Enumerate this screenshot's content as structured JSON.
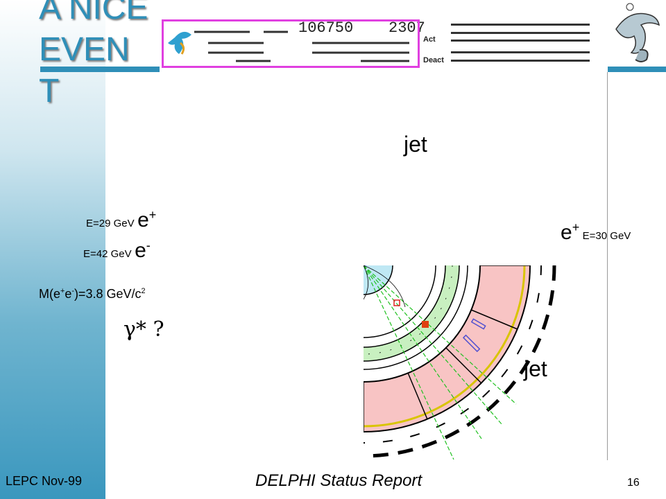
{
  "slide": {
    "title": "A NICE EVEN T",
    "footer_left": "LEPC Nov-99",
    "footer_center": "DELPHI Status Report",
    "page_number": "16"
  },
  "header": {
    "run_number": "106750",
    "event_number": "2307",
    "act_label": "Act",
    "deact_label": "Deact"
  },
  "labels": {
    "jet_top": "jet",
    "jet_bottom": "jet",
    "electron_pos_left_energy": "E=29 GeV",
    "electron_pos_left": "e",
    "electron_pos_left_charge": "+",
    "electron_neg_left_energy": "E=42 GeV",
    "electron_neg_left": "e",
    "electron_neg_left_charge": "-",
    "electron_pos_right": "e",
    "electron_pos_right_charge": "+",
    "electron_pos_right_energy": "E=30 GeV",
    "mass_prefix": "M(e",
    "mass_charge_plus": "+",
    "mass_mid": "e",
    "mass_charge_minus": "-",
    "mass_value": ")=3.8 GeV/c",
    "mass_exp": "2",
    "photon_question": "γ* ?"
  },
  "colors": {
    "accent": "#2f8fb8",
    "calorimeter": "#f8c4c4",
    "muon_ring": "#c8f0c0",
    "inner_detector": "#bfe8f4",
    "logo_border": "#e040e0"
  }
}
